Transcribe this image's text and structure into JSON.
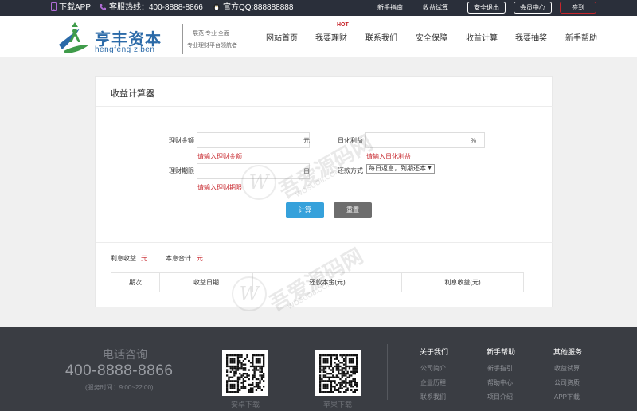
{
  "topbar": {
    "app_download": "下载APP",
    "hotline": "客服热线：400-8888-8866",
    "qq": "官方QQ:888888888",
    "guide": "新手指南",
    "calc": "收益试算",
    "logout": "安全退出",
    "member": "会员中心",
    "signin": "签到"
  },
  "header": {
    "brand_name": "亨丰资本",
    "brand_pinyin": "hengfeng ziben",
    "slogan_1": "展范 专业 全面",
    "slogan_2": "专业理财平台领航者",
    "nav": [
      "网站首页",
      "我要理财",
      "联系我们",
      "安全保障",
      "收益计算",
      "我要抽奖",
      "新手帮助"
    ],
    "hot_tag": "HOT"
  },
  "calculator": {
    "title": "收益计算器",
    "amount_label": "理财金额",
    "amount_value": "",
    "amount_unit": "元",
    "amount_error": "请输入理财金额",
    "rate_label": "日化利益",
    "rate_value": "",
    "rate_unit": "%",
    "rate_error": "请输入日化利益",
    "period_label": "理财期限",
    "period_value": "",
    "period_unit": "日",
    "period_error": "请输入理财期限",
    "repay_label": "还款方式",
    "repay_selected": "每日返息，到期还本",
    "calc_button": "计算",
    "reset_button": "重置"
  },
  "result": {
    "interest_label": "利息收益",
    "interest_unit": "元",
    "total_label": "本息合计",
    "total_unit": "元",
    "columns": [
      "期次",
      "收益日期",
      "还款本金(元)",
      "利息收益(元)"
    ]
  },
  "watermark": {
    "text_cn": "吾爱源码网",
    "text_url": "WOSUO8.COM",
    "logo": "W"
  },
  "footer": {
    "phone_title": "电话咨询",
    "phone": "400-8888-8866",
    "hours": "(服务时间：9:00~22:00)",
    "android": "安卓下载",
    "iphone": "苹果下载",
    "col1_title": "关于我们",
    "col1_links": [
      "公司简介",
      "企业历程",
      "联系我们"
    ],
    "col2_title": "新手帮助",
    "col2_links": [
      "新手指引",
      "帮助中心",
      "项目介绍"
    ],
    "col3_title": "其他服务",
    "col3_links": [
      "收益试算",
      "公司资质",
      "APP下载"
    ]
  },
  "colors": {
    "topbar_bg": "#2a2f3a",
    "brand_blue": "#2b6aa8",
    "error_red": "#c7262c",
    "calc_button": "#36a1db",
    "reset_button": "#6d6d6d",
    "footer_bg": "#3a3d43"
  }
}
